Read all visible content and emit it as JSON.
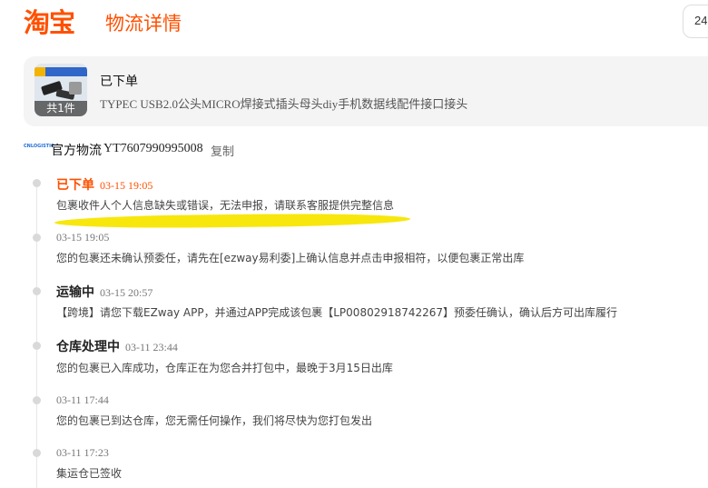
{
  "header": {
    "logo": "淘宝",
    "title": "物流详情",
    "search_value": "24"
  },
  "order": {
    "status": "已下单",
    "product_name": "TYPEC USB2.0公头MICRO焊接式插头母头diy手机数据线配件接口接头",
    "item_count": "共1件"
  },
  "carrier": {
    "logo_text": "CNLOGISTIC",
    "name": "官方物流",
    "tracking_number": "YT7607990995008",
    "copy_label": "复制"
  },
  "timeline": [
    {
      "status": "已下单",
      "time": "03-15 19:05",
      "description": "包裹收件人个人信息缺失或错误，无法申报，请联系客服提供完整信息",
      "active": true
    },
    {
      "status": "",
      "time": "03-15 19:05",
      "description": "您的包裹还未确认预委任，请先在[ezway易利委]上确认信息并点击申报相符，以便包裹正常出库"
    },
    {
      "status": "运输中",
      "time": "03-15 20:57",
      "description": "【跨境】请您下载EZway APP，并通过APP完成该包裹【LP00802918742267】预委任确认，确认后方可出库履行"
    },
    {
      "status": "仓库处理中",
      "time": "03-11 23:44",
      "description": "您的包裹已入库成功，仓库正在为您合并打包中，最晚于3月15日出库"
    },
    {
      "status": "",
      "time": "03-11 17:44",
      "description": "您的包裹已到达仓库，您无需任何操作，我们将尽快为您打包发出"
    },
    {
      "status": "",
      "time": "03-11 17:23",
      "description": "集运仓已签收"
    }
  ],
  "colors": {
    "accent": "#ff5000",
    "highlight": "#f7e600"
  }
}
